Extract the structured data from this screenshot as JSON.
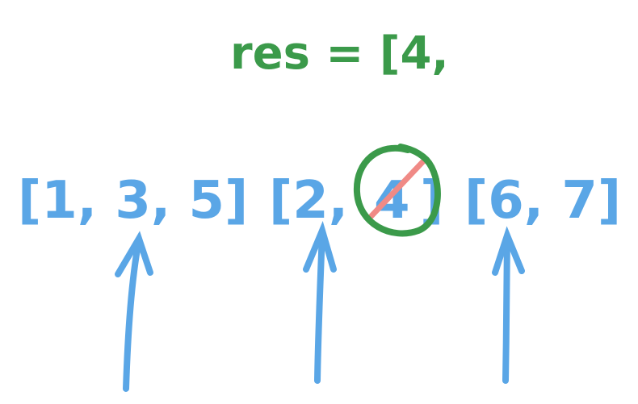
{
  "result_label": "res = [4,",
  "arrays": [
    {
      "text": "[1, 3, 5]"
    },
    {
      "text": "[2, ",
      "struck_value": "4",
      "close": "]"
    },
    {
      "text": "[6, 7]"
    }
  ],
  "pointer_count": 3,
  "colors": {
    "result": "#3b9a4a",
    "arrays": "#5aa6e6",
    "strike": "#f08a86",
    "circle": "#3b9a4a",
    "arrow": "#5aa6e6"
  }
}
